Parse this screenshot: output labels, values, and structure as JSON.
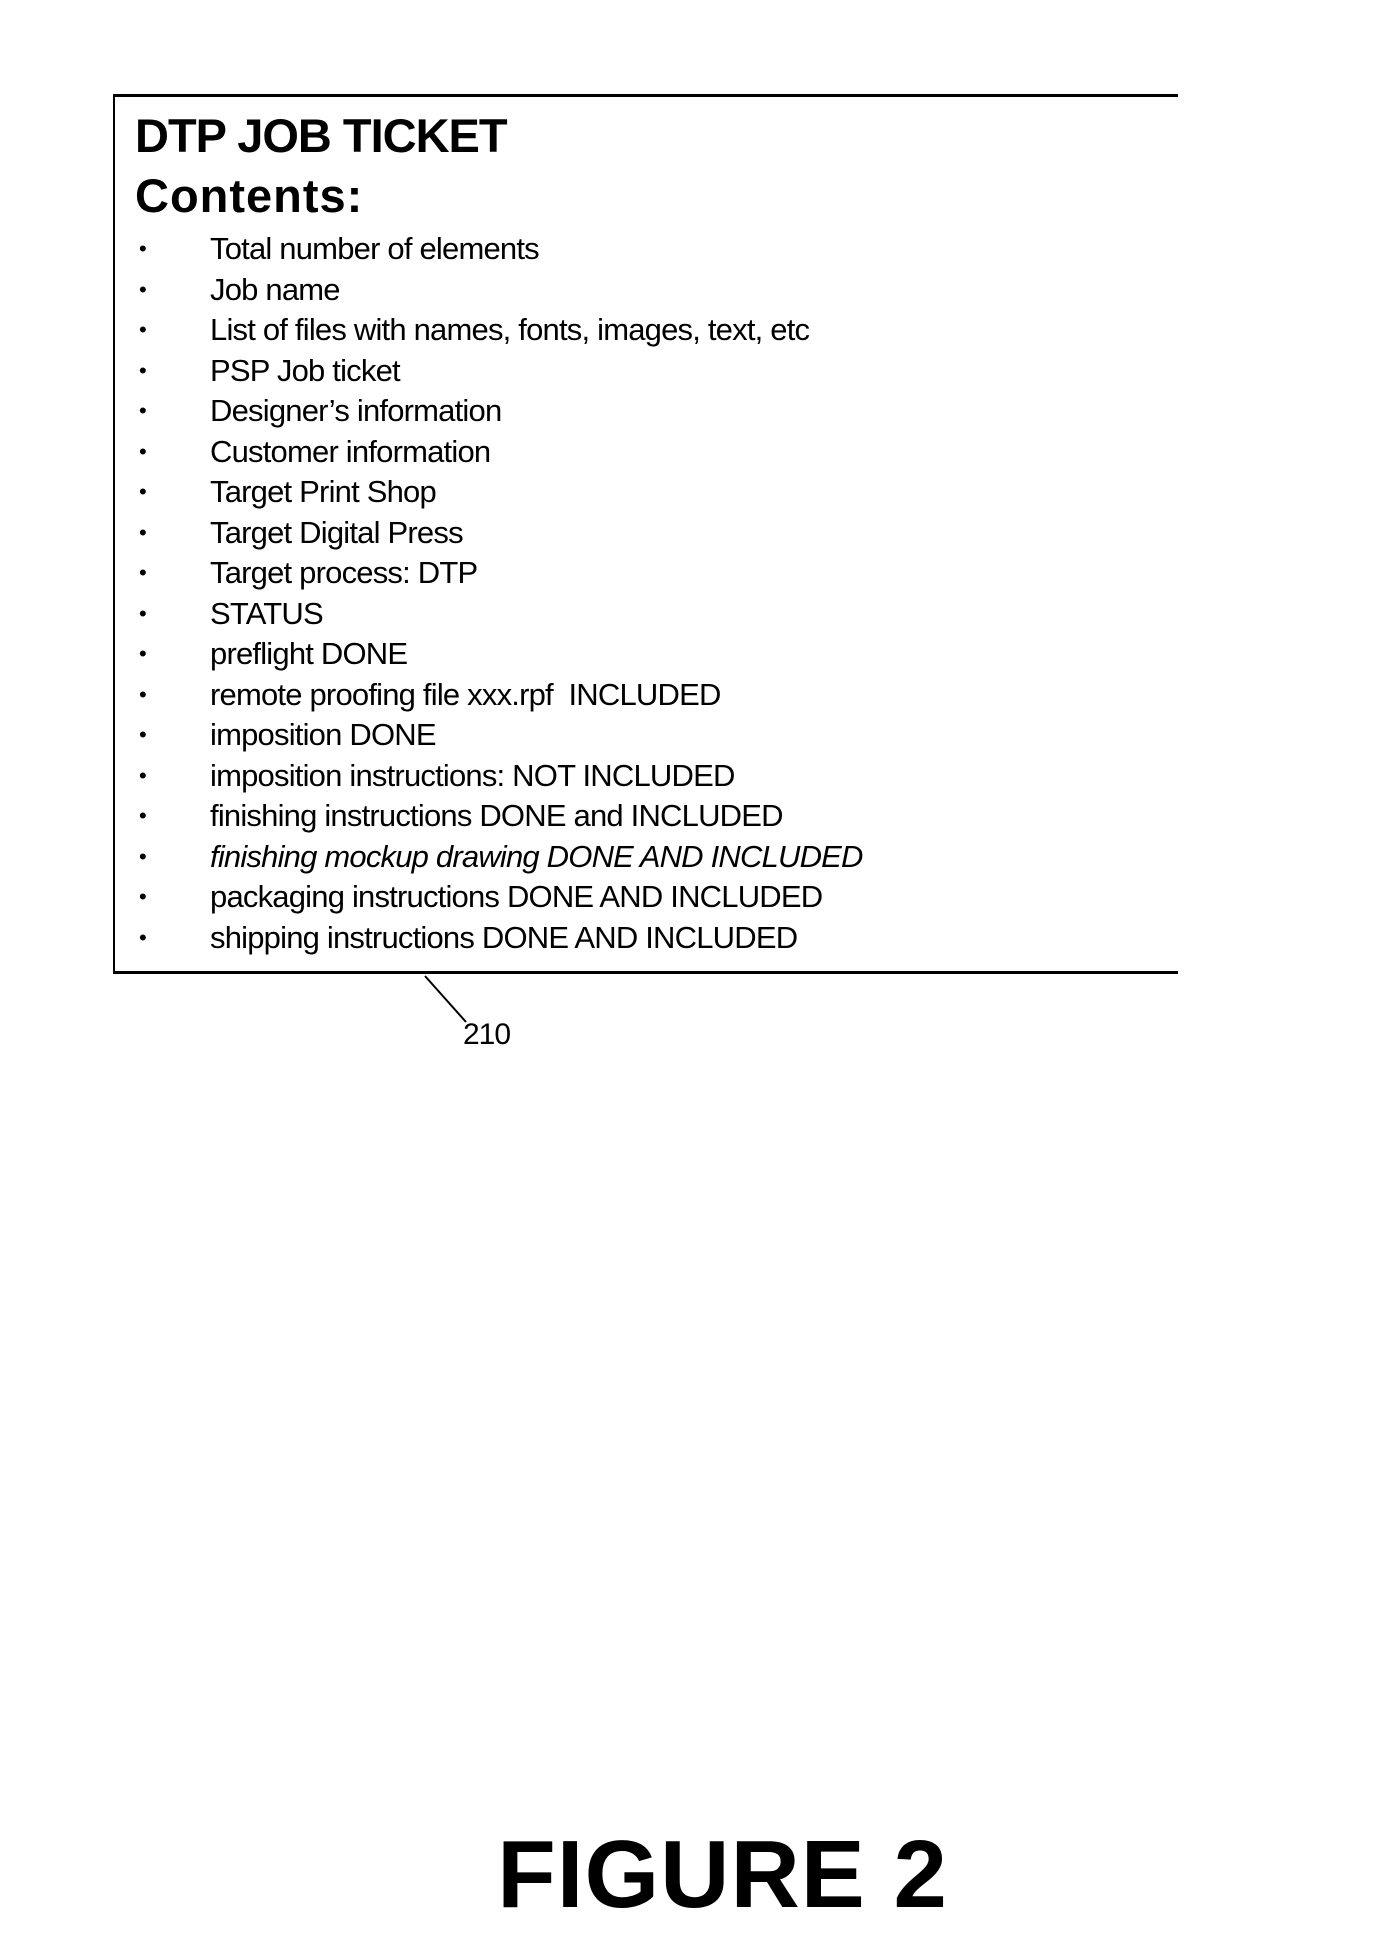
{
  "ticket": {
    "title": "DTP JOB TICKET",
    "subtitle": "Contents:",
    "bullet_glyph": "•",
    "items": [
      "Total number of elements",
      "Job name",
      "List of files with names, fonts, images, text, etc",
      "PSP Job ticket",
      "Designer’s information",
      "Customer information",
      "Target Print Shop",
      "Target Digital Press",
      "Target process: DTP",
      "STATUS",
      "preflight DONE",
      "remote proofing file xxx.rpf  INCLUDED",
      "imposition DONE",
      "imposition instructions: NOT INCLUDED",
      "finishing instructions DONE and INCLUDED",
      "finishing mockup drawing DONE AND INCLUDED",
      "packaging instructions DONE AND INCLUDED",
      "shipping instructions DONE AND INCLUDED"
    ]
  },
  "reference_numeral": "210",
  "figure_label": "FIGURE 2"
}
